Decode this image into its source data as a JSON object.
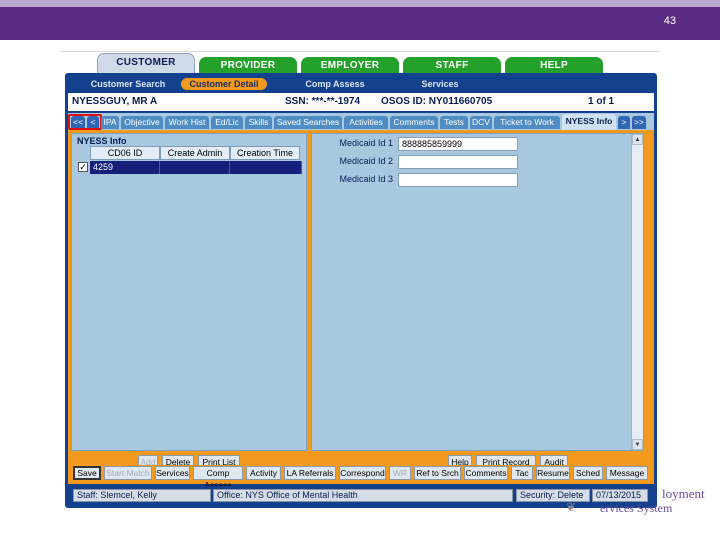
{
  "slide": {
    "number": "43"
  },
  "brand": {
    "line1": "loyment",
    "line2": "ervices System",
    "seal": "❦"
  },
  "top_tabs": [
    "CUSTOMER",
    "PROVIDER",
    "EMPLOYER",
    "STAFF",
    "HELP"
  ],
  "subnav": [
    "Customer Search",
    "Customer Detail",
    "Comp Assess",
    "Services"
  ],
  "info": {
    "name": "NYESSGUY, MR A",
    "ssn": "SSN: ***-**-1974",
    "osos_id": "OSOS ID: NY011660705",
    "page": "1 of 1"
  },
  "detail_tabs": {
    "first": "<<",
    "prev": "<",
    "items": [
      "IPA",
      "Objective",
      "Work Hist",
      "Ed/Lic",
      "Skills",
      "Saved Searches",
      "Activities",
      "Comments",
      "Tests",
      "DCV",
      "Ticket to Work",
      "NYESS Info"
    ],
    "next": ">",
    "last": ">>"
  },
  "left_panel": {
    "title": "NYESS Info",
    "columns": [
      "CD06 ID",
      "Create Admin",
      "Creation Time"
    ],
    "rows": [
      {
        "checked": "✓",
        "cd06_id": "4259",
        "create_admin": "",
        "creation_time": ""
      }
    ],
    "buttons": {
      "add": "Add",
      "delete": "Delete",
      "print_list": "Print List"
    }
  },
  "right_panel": {
    "fields": [
      {
        "label": "Medicaid Id 1",
        "value": "888885859999"
      },
      {
        "label": "Medicaid Id 2",
        "value": ""
      },
      {
        "label": "Medicaid Id 3",
        "value": ""
      }
    ],
    "buttons": {
      "help": "Help",
      "print_record": "Print Record",
      "audit": "Audit"
    }
  },
  "bottom_buttons": [
    "Save",
    "Start Match",
    "Services",
    "Comp Assess",
    "Activity",
    "LA Referrals",
    "Correspond",
    "WR",
    "Ref to Srch",
    "Comments",
    "Tac",
    "Resume",
    "Sched",
    "Message"
  ],
  "status": {
    "staff": "Staff: Slemcel, Kelly",
    "office": "Office: NYS Office of Mental Health",
    "security": "Security: Delete",
    "date": "07/13/2015"
  },
  "colors": {
    "header": "#5a2d82",
    "nav_green": "#24a12a",
    "frame_blue": "#13418e",
    "accent_orange": "#f29a1d",
    "panel_blue": "#a8c8e0",
    "row_selected": "#14207a"
  }
}
